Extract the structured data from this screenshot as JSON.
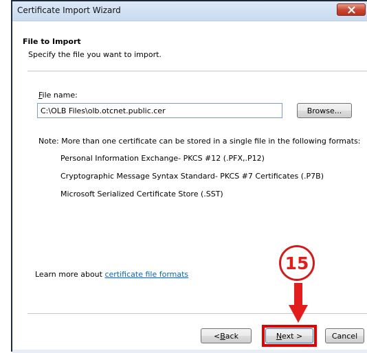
{
  "window": {
    "title": "Certificate Import Wizard",
    "close_icon": "close-icon"
  },
  "header": {
    "title": "File to Import",
    "description": "Specify the file you want to import."
  },
  "file": {
    "label_access": "F",
    "label_rest": "ile name:",
    "value": "C:\\OLB Files\\olb.otcnet.public.cer",
    "browse_label": "Browse..."
  },
  "note": {
    "text": "Note:  More than one certificate can be stored in a single file in the following formats:",
    "formats": [
      "Personal Information Exchange- PKCS #12 (.PFX,.P12)",
      "Cryptographic Message Syntax Standard- PKCS #7 Certificates (.P7B)",
      "Microsoft Serialized Certificate Store (.SST)"
    ]
  },
  "learn": {
    "prefix": "Learn more about ",
    "link": "certificate file formats"
  },
  "buttons": {
    "back_access": "B",
    "back_prefix": "< ",
    "back_rest": "ack",
    "next_access": "N",
    "next_rest": "ext >",
    "cancel": "Cancel"
  },
  "annotation": {
    "step": "15",
    "color": "#e11d1d"
  }
}
